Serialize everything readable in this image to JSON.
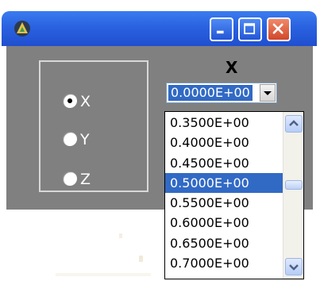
{
  "window": {
    "controls": {
      "minimize_icon": "minimize-icon",
      "maximize_icon": "maximize-icon",
      "close_icon": "close-icon"
    },
    "app_icon": "app-icon"
  },
  "axis_group": {
    "options": [
      {
        "label": "X",
        "selected": true
      },
      {
        "label": "Y",
        "selected": false
      },
      {
        "label": "Z",
        "selected": false
      }
    ]
  },
  "combo": {
    "title": "X",
    "value": "0.0000E+00"
  },
  "dropdown": {
    "items": [
      "0.3500E+00",
      "0.4000E+00",
      "0.4500E+00",
      "0.5000E+00",
      "0.5500E+00",
      "0.6000E+00",
      "0.6500E+00",
      "0.7000E+00"
    ],
    "highlighted": "0.5000E+00"
  },
  "colors": {
    "titlebar": "#2a62e0",
    "client_bg": "#808080",
    "selection": "#316ac5"
  }
}
